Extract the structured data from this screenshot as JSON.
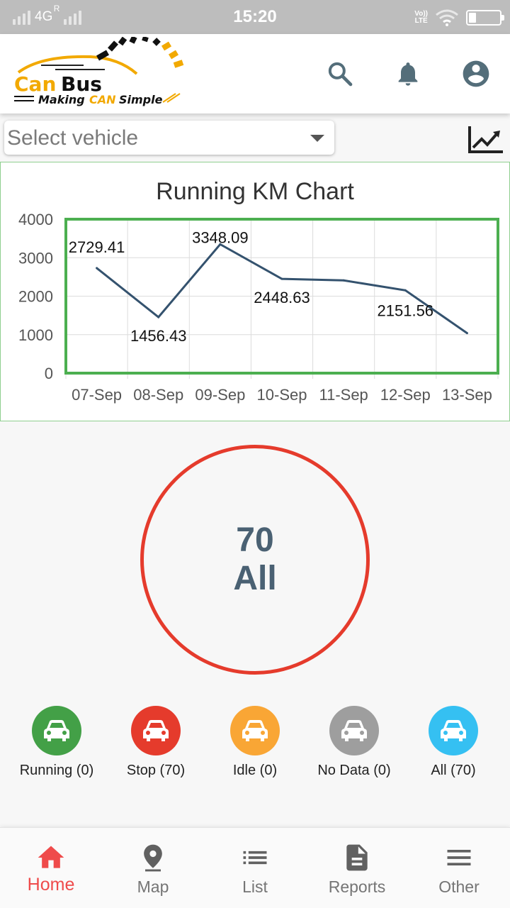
{
  "status_bar": {
    "network": "4G",
    "roaming": "R",
    "time": "15:20",
    "volte_top": "Vo))",
    "volte_bottom": "LTE"
  },
  "app_bar": {
    "logo_brand": "CanBus",
    "logo_tagline_a": "Making ",
    "logo_tagline_b": "CAN",
    "logo_tagline_c": " Simple",
    "icons": [
      "search-icon",
      "bell-icon",
      "account-icon"
    ]
  },
  "vehicle_select": {
    "placeholder": "Select vehicle",
    "trend_icon": "trending-up-icon"
  },
  "chart_data": {
    "type": "line",
    "title": "Running KM Chart",
    "categories": [
      "07-Sep",
      "08-Sep",
      "09-Sep",
      "10-Sep",
      "11-Sep",
      "12-Sep",
      "13-Sep"
    ],
    "values": [
      2729.41,
      1456.43,
      3348.09,
      2448.63,
      2410,
      2151.56,
      1040
    ],
    "data_labels": [
      "2729.41",
      "1456.43",
      "3348.09",
      "2448.63",
      "",
      "2151.56",
      ""
    ],
    "yticks": [
      "4000",
      "3000",
      "2000",
      "1000",
      "0"
    ],
    "ylim": [
      0,
      4000
    ],
    "grid": true,
    "line_color": "#34526e",
    "frame_color": "#4caf50"
  },
  "summary": {
    "count": "70",
    "label": "All",
    "ring_color": "#e53b2c"
  },
  "filters": [
    {
      "label": "Running (0)",
      "color": "#43a047",
      "icon": "car-icon"
    },
    {
      "label": "Stop (70)",
      "color": "#e53b2c",
      "icon": "car-icon"
    },
    {
      "label": "Idle (0)",
      "color": "#f9a635",
      "icon": "car-icon"
    },
    {
      "label": "No Data (0)",
      "color": "#9e9e9e",
      "icon": "car-icon"
    },
    {
      "label": "All (70)",
      "color": "#35c0f2",
      "icon": "car-icon"
    }
  ],
  "bottom_nav": [
    {
      "label": "Home",
      "icon": "home-icon",
      "active": true
    },
    {
      "label": "Map",
      "icon": "map-pin-icon",
      "active": false
    },
    {
      "label": "List",
      "icon": "list-icon",
      "active": false
    },
    {
      "label": "Reports",
      "icon": "document-icon",
      "active": false
    },
    {
      "label": "Other",
      "icon": "menu-icon",
      "active": false
    }
  ],
  "colors": {
    "accent": "#ef4b4b",
    "icon_grey": "#546e7a",
    "nav_grey": "#616161"
  }
}
